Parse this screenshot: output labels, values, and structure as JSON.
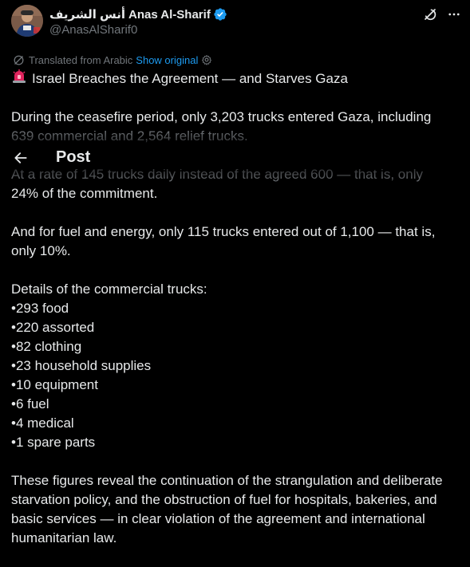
{
  "author": {
    "name_arabic": "أنس الشريف",
    "name_latin": "Anas Al-Sharif",
    "handle": "@AnasAlSharif0",
    "verified": true
  },
  "header": {
    "title": "Post",
    "back_icon": "arrow-left-icon"
  },
  "top_icons": [
    "grok-icon",
    "more-dots-icon"
  ],
  "translation": {
    "label": "Translated from Arabic",
    "link": "Show original"
  },
  "post": {
    "headline_icon": "rotating-light-emoji",
    "headline": "Israel Breaches the Agreement — and Starves Gaza",
    "para1_line1": "During the ceasefire period, only 3,203 trucks entered Gaza, including",
    "para1_line2": "639 commercial and 2,564 relief trucks.",
    "para2_line1": "At a rate of 145 trucks daily instead of the agreed 600 — that is, only",
    "para2_line2": "24% of the commitment.",
    "para3_line1": "And for fuel and energy, only 115 trucks entered out of 1,100 — that is,",
    "para3_line2": "only 10%.",
    "details_heading": "Details of the commercial trucks:",
    "details": [
      "•293 food",
      "•220 assorted",
      "•82 clothing",
      "•23 household supplies",
      "•10 equipment",
      "•6 fuel",
      "•4 medical",
      "•1 spare parts"
    ],
    "closing_line1": "These figures reveal the continuation of the strangulation and deliberate",
    "closing_line2": "starvation policy, and the obstruction of fuel for hospitals, bakeries, and",
    "closing_line3": "basic services — in clear violation of the agreement and international",
    "closing_line4": "humanitarian law."
  },
  "colors": {
    "background": "#000000",
    "text": "#e7e9ea",
    "secondary": "#71767b",
    "link": "#1d9bf0",
    "verified": "#1d9bf0"
  }
}
